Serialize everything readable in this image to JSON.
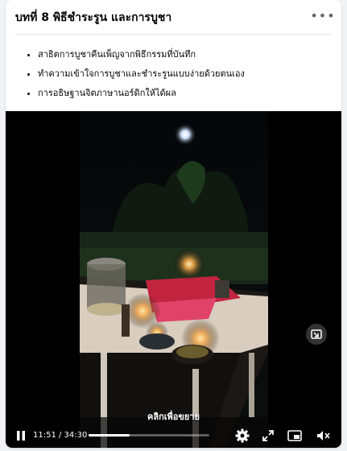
{
  "post": {
    "title": "บทที่ 8 พิธีชำระรูน และการบูชา",
    "menu_icon": "more-icon",
    "bullets": [
      "สาธิตการบูชาคืนเพ็ญจากพิธีกรรมที่บันทึก",
      "ทำความเข้าใจการบูชาและชำระรูนแบบง่ายด้วยตนเอง",
      "การอธิษฐานจิตภาษานอร์ดิกให้ได้ผล"
    ]
  },
  "video": {
    "caption": "คลิกเพื่อขยาย",
    "current_time": "11:51",
    "duration": "34:30",
    "time_text": "11:51 / 34:30",
    "progress": 0.34,
    "icons": [
      "pause-icon",
      "settings-icon",
      "expand-icon",
      "pip-icon",
      "volume-muted-icon",
      "picture-in-picture-icon"
    ]
  }
}
